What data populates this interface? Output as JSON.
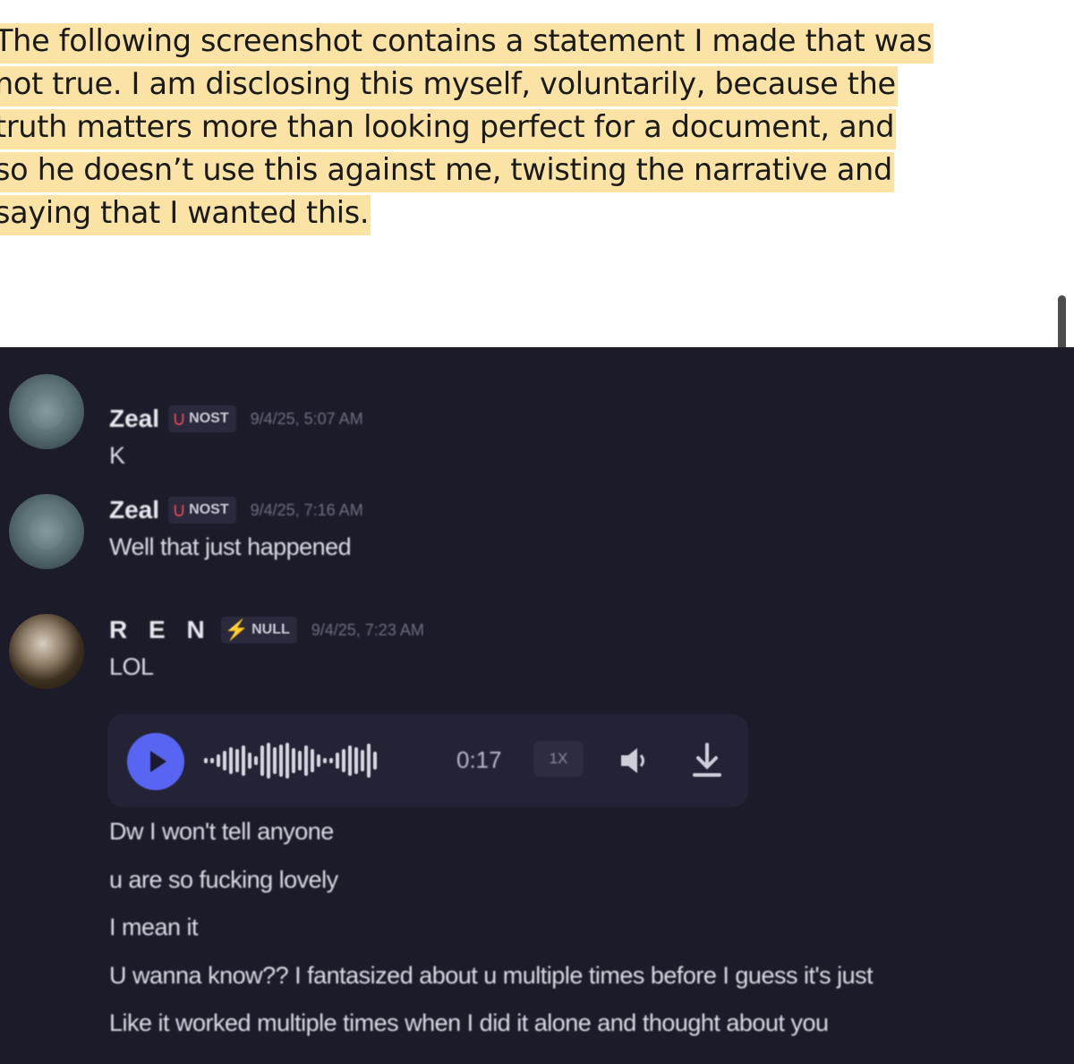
{
  "document": {
    "lines": [
      "The following screenshot contains a statement I made that was",
      "not true. I am disclosing this myself, voluntarily, because the",
      "truth matters more than looking perfect for a document, and",
      "so he doesn’t use this against me, twisting the narrative and",
      "saying that I wanted this."
    ],
    "highlight_color": "#fbe3a6"
  },
  "chat": {
    "background": "#1c1b2a",
    "messages": [
      {
        "author": "Zeal",
        "tag": "NOST",
        "tag_icon": "horseshoe-icon",
        "time": "9/4/25, 5:07 AM",
        "text": "K"
      },
      {
        "author": "Zeal",
        "tag": "NOST",
        "tag_icon": "horseshoe-icon",
        "time": "9/4/25, 7:16 AM",
        "text": "Well that just happened"
      },
      {
        "author": "R E N",
        "tag": "NULL",
        "tag_icon": "lightning-icon",
        "time": "9/4/25, 7:23 AM",
        "text": "LOL"
      }
    ],
    "audio": {
      "duration": "0:17",
      "speed": "1X",
      "accent": "#5865f2"
    },
    "follow_up": [
      "Dw I won't tell anyone",
      "u are so fucking lovely",
      "I mean it",
      "U wanna know?? I fantasized about u multiple times before I guess it's just",
      "Like it worked multiple times when I did it alone and thought about you"
    ]
  }
}
